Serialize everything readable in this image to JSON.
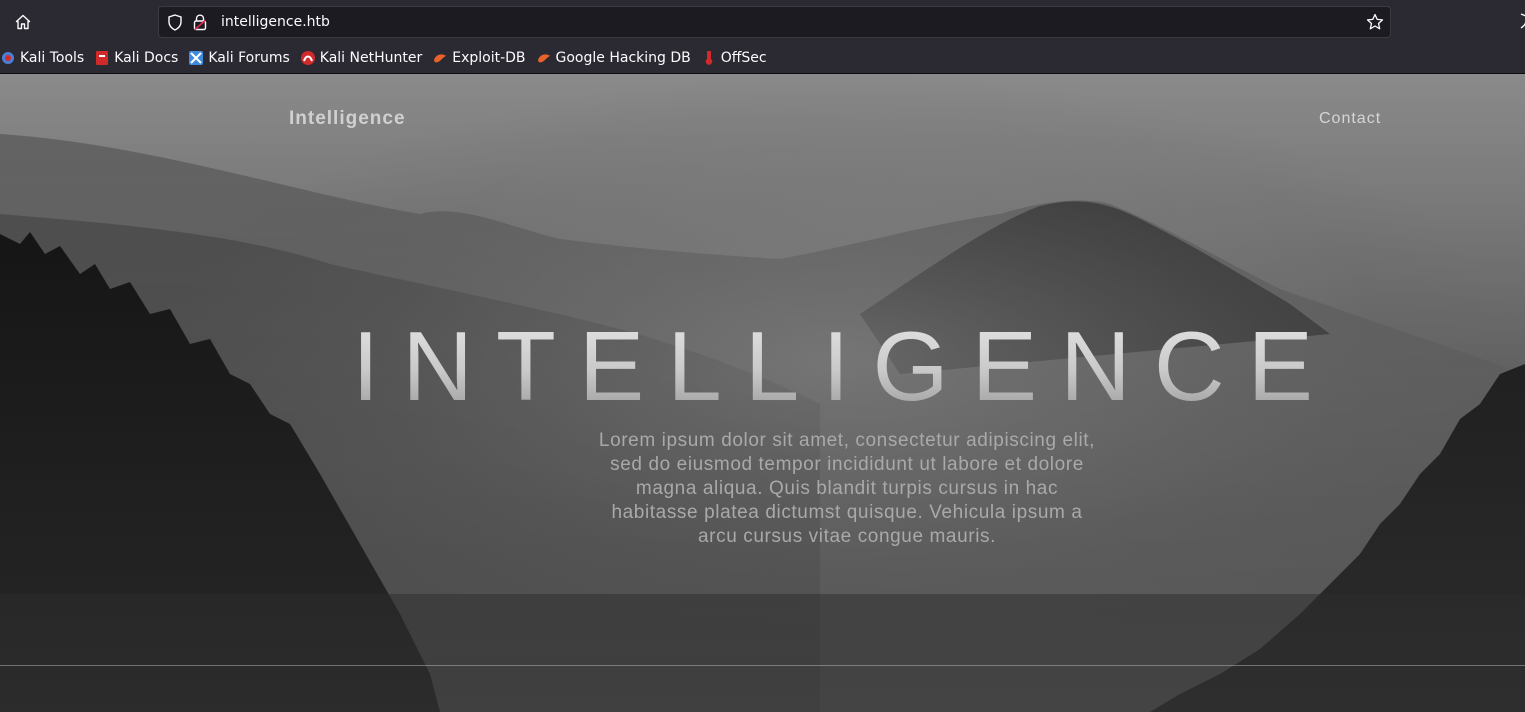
{
  "browser": {
    "url": "intelligence.htb",
    "bookmarks": [
      {
        "label": "Kali Tools",
        "icon": "kali-tools-icon",
        "color": "#4a7fd6"
      },
      {
        "label": "Kali Docs",
        "icon": "kali-docs-icon",
        "color": "#d12a2a"
      },
      {
        "label": "Kali Forums",
        "icon": "kali-forums-icon",
        "color": "#3d8be0"
      },
      {
        "label": "Kali NetHunter",
        "icon": "kali-nethunter-icon",
        "color": "#d12a2a"
      },
      {
        "label": "Exploit-DB",
        "icon": "exploit-db-icon",
        "color": "#e8622a"
      },
      {
        "label": "Google Hacking DB",
        "icon": "google-hacking-db-icon",
        "color": "#e8622a"
      },
      {
        "label": "OffSec",
        "icon": "offsec-icon",
        "color": "#d12a2a"
      }
    ]
  },
  "site": {
    "brand": "Intelligence",
    "nav": {
      "contact": "Contact"
    },
    "hero": {
      "title": "INTELLIGENCE",
      "text": "Lorem ipsum dolor sit amet, consectetur adipiscing elit, sed do eiusmod tempor incididunt ut labore et dolore magna aliqua. Quis blandit turpis cursus in hac habitasse platea dictumst quisque. Vehicula ipsum a arcu cursus vitae congue mauris."
    }
  },
  "colors": {
    "chrome_bg": "#2b2a33",
    "urlbar_bg": "#1c1b22",
    "chrome_text": "#fbfbfe"
  }
}
